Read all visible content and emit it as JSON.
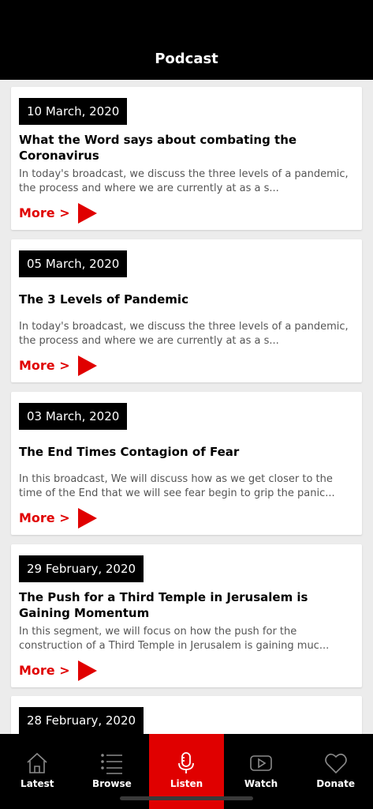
{
  "header": {
    "title": "Podcast"
  },
  "items": [
    {
      "date": "10 March, 2020",
      "title": "What the Word says about combating the Coronavirus",
      "description": "In today's broadcast, we discuss the three levels of a pandemic, the process and where we are currently at as a s...",
      "more_label": "More >"
    },
    {
      "date": "05 March, 2020",
      "title": "The 3 Levels of Pandemic",
      "description": "In today's broadcast, we discuss the three levels of a pandemic, the process and where we are currently at as a s...",
      "more_label": "More >"
    },
    {
      "date": "03 March, 2020",
      "title": "The End Times Contagion of Fear",
      "description": "In this broadcast, We will discuss how as we get closer to the time of the End that we will see fear begin to grip the panic...",
      "more_label": "More >"
    },
    {
      "date": "29 February, 2020",
      "title": "The Push for a Third Temple in Jerusalem is Gaining Momentum",
      "description": "In this segment, we will focus on how the push for the construction of a Third Temple in Jerusalem is gaining muc...",
      "more_label": "More >"
    },
    {
      "date": "28 February, 2020"
    }
  ],
  "tabbar": {
    "tabs": [
      {
        "label": "Latest",
        "icon": "home-icon"
      },
      {
        "label": "Browse",
        "icon": "list-icon"
      },
      {
        "label": "Listen",
        "icon": "microphone-icon",
        "active": true
      },
      {
        "label": "Watch",
        "icon": "video-play-icon"
      },
      {
        "label": "Donate",
        "icon": "heart-icon"
      }
    ]
  },
  "colors": {
    "accent": "#e00000",
    "background": "#ececec",
    "bars": "#000000"
  }
}
